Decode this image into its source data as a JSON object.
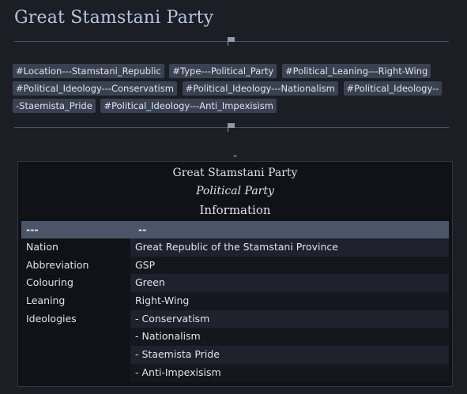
{
  "page": {
    "title": "Great Stamstani Party"
  },
  "tags": [
    "#Location---Stamstani_Republic",
    "#Type---Political_Party",
    "#Political_Leaning---Right-Wing",
    "#Political_Ideology---Conservatism",
    "#Political_Ideology---Nationalism",
    "#Political_Ideology---Staemista_Pride",
    "#Political_Ideology---Anti_Impexisism"
  ],
  "icons": {
    "divider": "flag-icon",
    "collapse": "chevron-down-icon",
    "collapse_glyph": "⌄"
  },
  "infobox": {
    "name": "Great Stamstani Party",
    "type": "Political Party",
    "section": "Information",
    "columns": [
      "---",
      "--"
    ],
    "rows": [
      {
        "label": "Nation",
        "value": "Great Republic of the Stamstani Province"
      },
      {
        "label": "Abbreviation",
        "value": "GSP"
      },
      {
        "label": "Colouring",
        "value": "Green"
      },
      {
        "label": "Leaning",
        "value": "Right-Wing"
      },
      {
        "label": "Ideologies",
        "value": "- Conservatism"
      },
      {
        "label": "",
        "value": "- Nationalism"
      },
      {
        "label": "",
        "value": "- Staemista Pride"
      },
      {
        "label": "",
        "value": "- Anti-Impexisism"
      }
    ]
  }
}
